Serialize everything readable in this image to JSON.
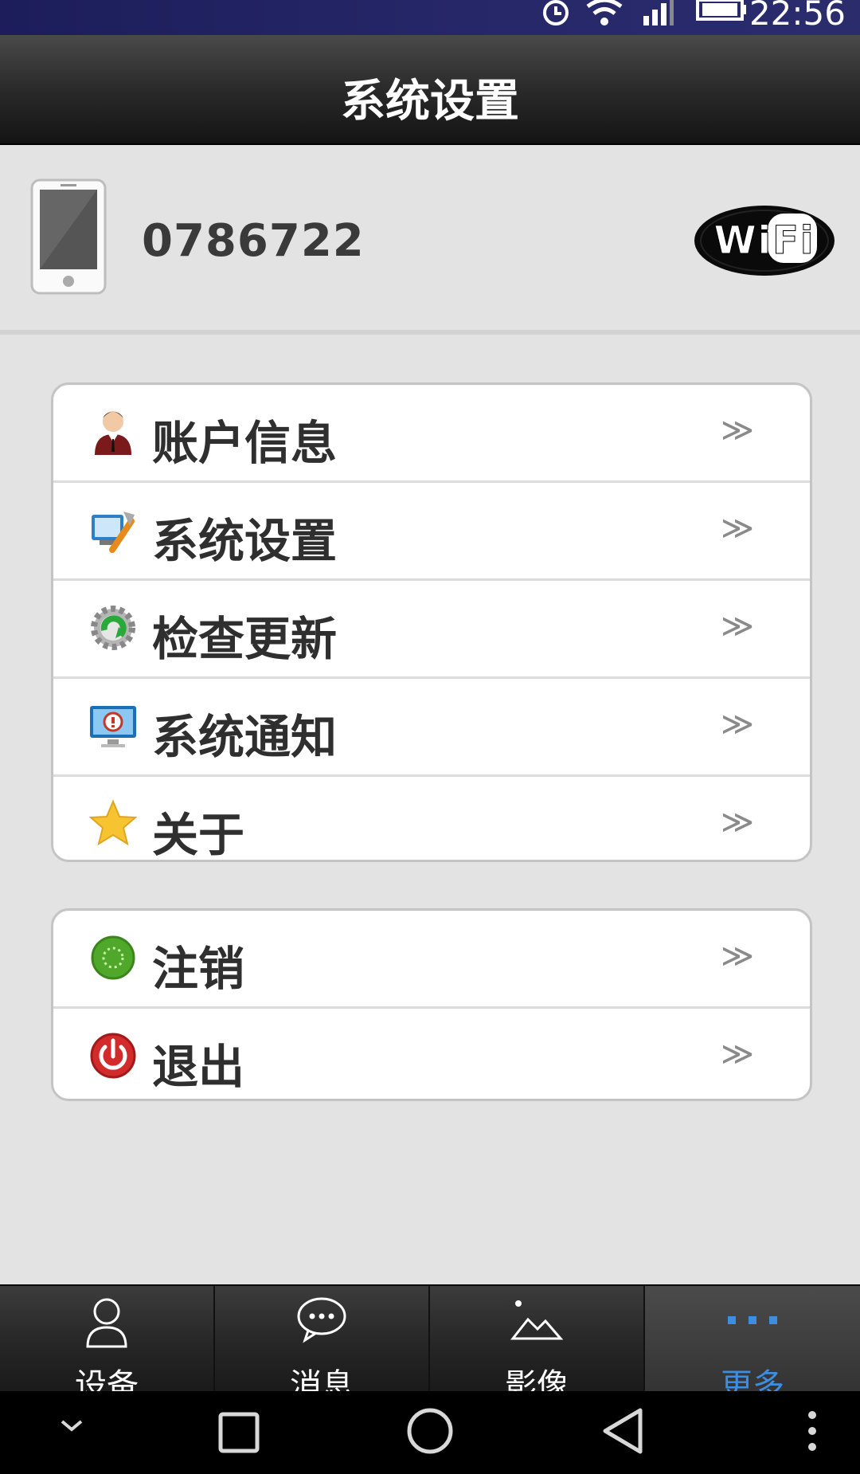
{
  "status_bar": {
    "time": "22:56",
    "icons": [
      "alarm-icon",
      "wifi-signal-icon",
      "cell-signal-icon",
      "battery-icon"
    ]
  },
  "header": {
    "title": "系统设置"
  },
  "device": {
    "id": "0786722",
    "icons": [
      "phone-icon",
      "wifi-logo-icon"
    ],
    "wifi_logo_text": "WiFi"
  },
  "menu_group_1": [
    {
      "label": "账户信息",
      "icon": "user-avatar-icon",
      "chevron": "≫"
    },
    {
      "label": "系统设置",
      "icon": "settings-tools-icon",
      "chevron": "≫"
    },
    {
      "label": "检查更新",
      "icon": "update-gear-icon",
      "chevron": "≫"
    },
    {
      "label": "系统通知",
      "icon": "notification-monitor-icon",
      "chevron": "≫"
    },
    {
      "label": "关于",
      "icon": "star-icon",
      "chevron": "≫"
    }
  ],
  "menu_group_2": [
    {
      "label": "注销",
      "icon": "logout-green-icon",
      "chevron": "≫"
    },
    {
      "label": "退出",
      "icon": "power-icon",
      "chevron": "≫"
    }
  ],
  "tabs": [
    {
      "label": "设备",
      "icon": "person-outline-icon",
      "active": false
    },
    {
      "label": "消息",
      "icon": "chat-bubble-icon",
      "active": false
    },
    {
      "label": "影像",
      "icon": "image-mountain-icon",
      "active": false
    },
    {
      "label": "更多",
      "icon": "more-dots-icon",
      "active": true
    }
  ],
  "nav_bar": [
    "chevron-down-icon",
    "recent-square-icon",
    "home-circle-icon",
    "back-triangle-icon",
    "menu-dots-icon"
  ],
  "colors": {
    "active_tab": "#3d8de0",
    "title_bar": "#2a2a2a",
    "background": "#e3e3e3"
  }
}
